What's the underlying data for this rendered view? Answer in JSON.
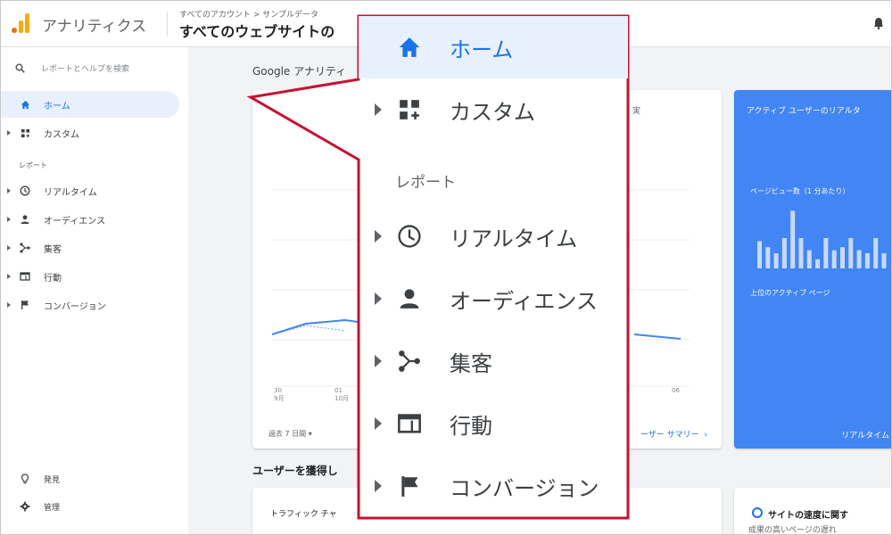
{
  "header": {
    "app_title": "アナリティクス",
    "breadcrumb": "すべてのアカウント > サンプルデータ",
    "view_title": "すべてのウェブサイトの"
  },
  "sidebar": {
    "search_placeholder": "レポートとヘルプを検索",
    "items": [
      {
        "label": "ホーム",
        "icon": "home-icon",
        "active": true
      },
      {
        "label": "カスタム",
        "icon": "dashboard-plus-icon"
      }
    ],
    "reports_label": "レポート",
    "report_items": [
      {
        "label": "リアルタイム",
        "icon": "clock-icon"
      },
      {
        "label": "オーディエンス",
        "icon": "person-icon"
      },
      {
        "label": "集客",
        "icon": "acquisition-icon"
      },
      {
        "label": "行動",
        "icon": "behavior-icon"
      },
      {
        "label": "コンバージョン",
        "icon": "flag-icon"
      }
    ],
    "bottom_items": [
      {
        "label": "発見",
        "icon": "lightbulb-icon"
      },
      {
        "label": "管理",
        "icon": "gear-icon"
      }
    ]
  },
  "main": {
    "title": "Google アナリティ",
    "card1_top": "実",
    "x_ticks": [
      {
        "day": "30",
        "month": "9月"
      },
      {
        "day": "01",
        "month": "10月"
      },
      {
        "day": "06",
        "month": ""
      }
    ],
    "date_range": "過去 7 日間",
    "summary_link": "ーザー サマリー",
    "realtime_title": "アクティブ ユーザーのリアルタ",
    "realtime_pageviews": "ページビュー数（1 分あたり）",
    "realtime_pages": "上位のアクティブ ページ",
    "realtime_link": "リアルタイム",
    "realtime_bars": [
      0.45,
      0.35,
      0.25,
      0.5,
      0.95,
      0.5,
      0.3,
      0.15,
      0.5,
      0.3,
      0.35,
      0.5,
      0.3,
      0.25,
      0.5,
      0.25
    ],
    "section2": "ユーザーを獲得し",
    "traffic_card": "トラフィック チャ",
    "speed_title": "サイトの速度に関す",
    "speed_sub": "成果の高いページの遅れ"
  },
  "zoom": {
    "home": "ホーム",
    "custom": "カスタム",
    "reports_label": "レポート",
    "realtime": "リアルタイム",
    "audience": "オーディエンス",
    "acquisition": "集客",
    "behavior": "行動",
    "conversion": "コンバージョン"
  },
  "colors": {
    "accent": "#1a73e8",
    "callout_border": "#c8102e",
    "realtime_bg": "#4285f4",
    "logo_orange": "#f9ab00"
  }
}
